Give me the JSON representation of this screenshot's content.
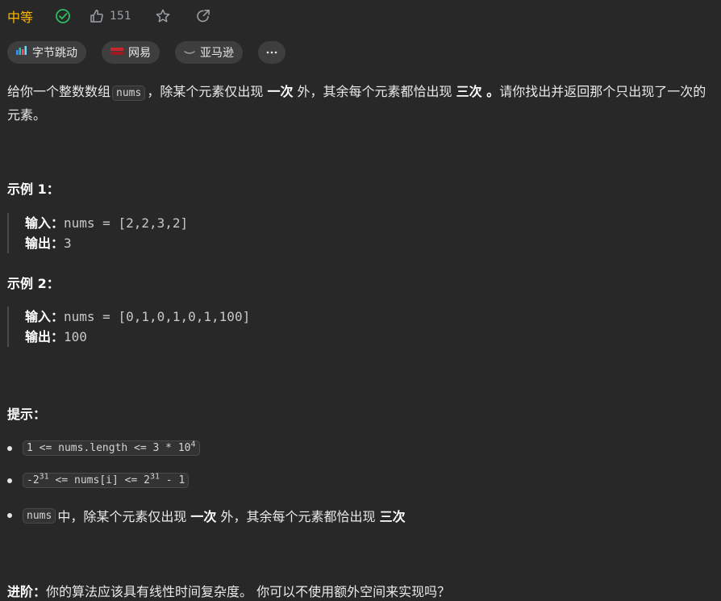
{
  "header": {
    "difficulty": "中等",
    "like_count": "151",
    "icons": [
      "solved-check-icon",
      "thumbs-up-icon",
      "star-icon",
      "share-icon"
    ],
    "difficulty_color": "#ffb800",
    "solved_color": "#2cbb5d"
  },
  "tags": [
    {
      "label": "字节跳动",
      "icon": "bytedance-logo"
    },
    {
      "label": "网易",
      "icon": "netease-logo"
    },
    {
      "label": "亚马逊",
      "icon": "amazon-logo"
    }
  ],
  "more_label": "···",
  "description": {
    "part1": "给你一个整数数组",
    "code1": "nums",
    "part2": "，除某个元素仅出现",
    "bold1": "一次",
    "part3": "外，其余每个元素都恰出现",
    "bold2": "三次 。",
    "part4": "请你找出并返回那个只出现了一次的元素。"
  },
  "examples": [
    {
      "title": "示例 1：",
      "input_label": "输入：",
      "input": "nums = [2,2,3,2]",
      "output_label": "输出：",
      "output": "3"
    },
    {
      "title": "示例 2：",
      "input_label": "输入：",
      "input": "nums = [0,1,0,1,0,1,100]",
      "output_label": "输出：",
      "output": "100"
    }
  ],
  "hints": {
    "title": "提示：",
    "c1_pre": "1 <= nums.length <= 3 * 10",
    "c1_sup": "4",
    "c2_a": "-2",
    "c2_sup1": "31",
    "c2_b": " <= nums[i] <= 2",
    "c2_sup2": "31",
    "c2_c": " - 1",
    "c3_code": "nums",
    "c3_part1": "中，除某个元素仅出现",
    "c3_bold1": "一次",
    "c3_part2": "外，其余每个元素都恰出现",
    "c3_bold2": "三次"
  },
  "followup": {
    "label": "进阶：",
    "text": "你的算法应该具有线性时间复杂度。 你可以不使用额外空间来实现吗？"
  }
}
